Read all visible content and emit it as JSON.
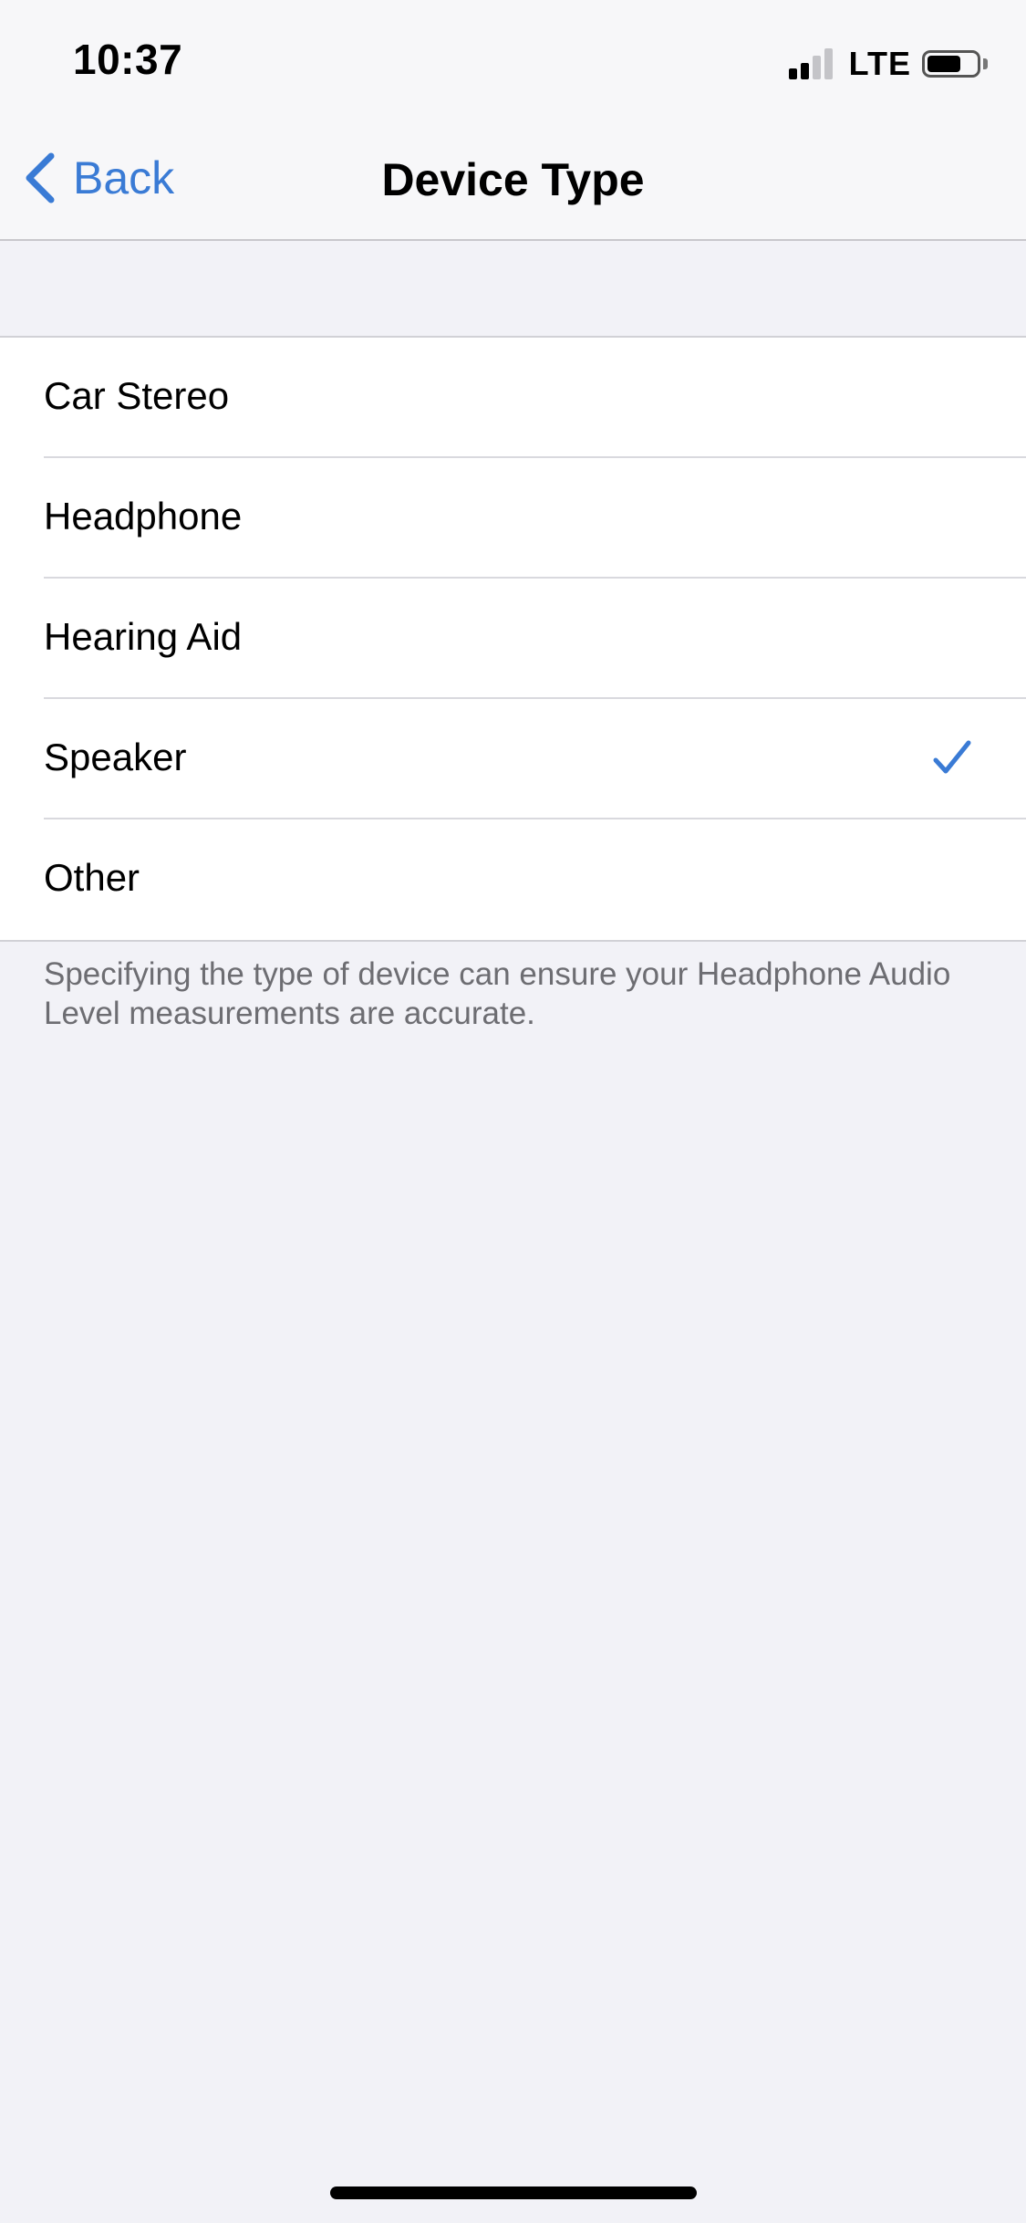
{
  "status_bar": {
    "time": "10:37",
    "network": "LTE",
    "signal_bars_active": 2,
    "signal_bars_total": 4,
    "battery_level_percent": 70
  },
  "nav": {
    "back_label": "Back",
    "title": "Device Type"
  },
  "device_types": [
    {
      "label": "Car Stereo",
      "selected": false
    },
    {
      "label": "Headphone",
      "selected": false
    },
    {
      "label": "Hearing Aid",
      "selected": false
    },
    {
      "label": "Speaker",
      "selected": true
    },
    {
      "label": "Other",
      "selected": false
    }
  ],
  "footer_note": "Specifying the type of device can ensure your Headphone Audio Level measurements are accurate.",
  "colors": {
    "accent": "#3a7bd5",
    "background": "#f2f2f7",
    "signal_active": "#000000",
    "signal_inactive": "#c4c4c8"
  },
  "icons": {
    "back": "chevron-left-icon",
    "selected": "checkmark-icon",
    "signal": "cellular-signal-icon",
    "battery": "battery-icon"
  }
}
